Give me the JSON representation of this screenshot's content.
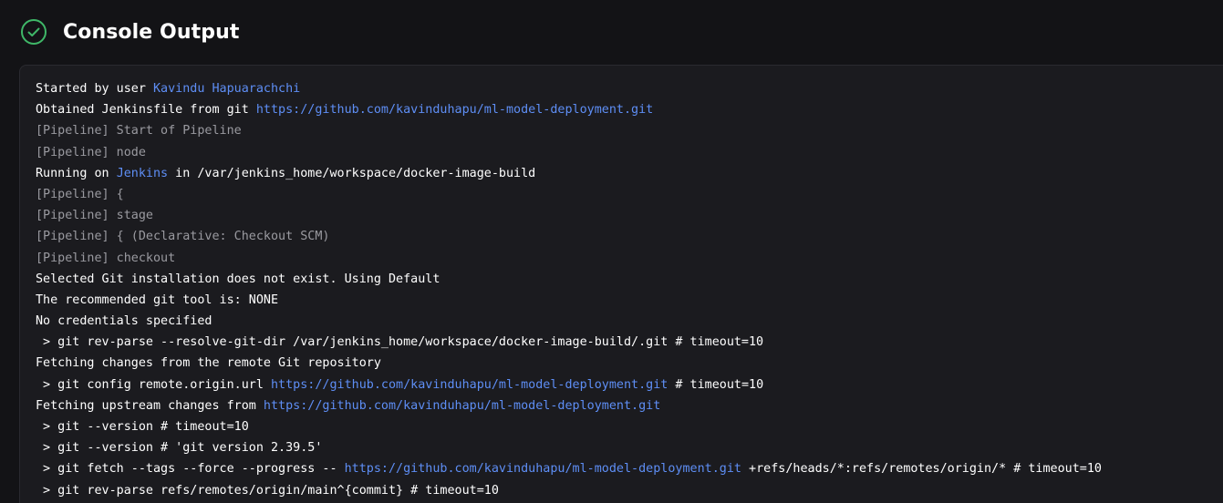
{
  "header": {
    "title": "Console Output",
    "status_icon": "check-circle-icon",
    "status_color": "#3fb768"
  },
  "colors": {
    "background": "#131316",
    "panel": "#1b1b1f",
    "text": "#ffffff",
    "muted": "#9a9aa0",
    "link": "#5e8ef5"
  },
  "console": {
    "lines": [
      [
        {
          "t": "Started by user "
        },
        {
          "t": "Kavindu Hapuarachchi",
          "link": true
        }
      ],
      [
        {
          "t": "Obtained Jenkinsfile from git "
        },
        {
          "t": "https://github.com/kavinduhapu/ml-model-deployment.git",
          "link": true
        }
      ],
      [
        {
          "t": "[Pipeline] Start of Pipeline",
          "muted": true
        }
      ],
      [
        {
          "t": "[Pipeline] node",
          "muted": true
        }
      ],
      [
        {
          "t": "Running on "
        },
        {
          "t": "Jenkins",
          "link": true
        },
        {
          "t": " in /var/jenkins_home/workspace/docker-image-build"
        }
      ],
      [
        {
          "t": "[Pipeline] {",
          "muted": true
        }
      ],
      [
        {
          "t": "[Pipeline] stage",
          "muted": true
        }
      ],
      [
        {
          "t": "[Pipeline] { (Declarative: Checkout SCM)",
          "muted": true
        }
      ],
      [
        {
          "t": "[Pipeline] checkout",
          "muted": true
        }
      ],
      [
        {
          "t": "Selected Git installation does not exist. Using Default"
        }
      ],
      [
        {
          "t": "The recommended git tool is: NONE"
        }
      ],
      [
        {
          "t": "No credentials specified"
        }
      ],
      [
        {
          "t": " > git rev-parse --resolve-git-dir /var/jenkins_home/workspace/docker-image-build/.git # timeout=10"
        }
      ],
      [
        {
          "t": "Fetching changes from the remote Git repository"
        }
      ],
      [
        {
          "t": " > git config remote.origin.url "
        },
        {
          "t": "https://github.com/kavinduhapu/ml-model-deployment.git",
          "link": true
        },
        {
          "t": " # timeout=10"
        }
      ],
      [
        {
          "t": "Fetching upstream changes from "
        },
        {
          "t": "https://github.com/kavinduhapu/ml-model-deployment.git",
          "link": true
        }
      ],
      [
        {
          "t": " > git --version # timeout=10"
        }
      ],
      [
        {
          "t": " > git --version # 'git version 2.39.5'"
        }
      ],
      [
        {
          "t": " > git fetch --tags --force --progress -- "
        },
        {
          "t": "https://github.com/kavinduhapu/ml-model-deployment.git",
          "link": true
        },
        {
          "t": " +refs/heads/*:refs/remotes/origin/* # timeout=10"
        }
      ],
      [
        {
          "t": " > git rev-parse refs/remotes/origin/main^{commit} # timeout=10"
        }
      ]
    ]
  }
}
